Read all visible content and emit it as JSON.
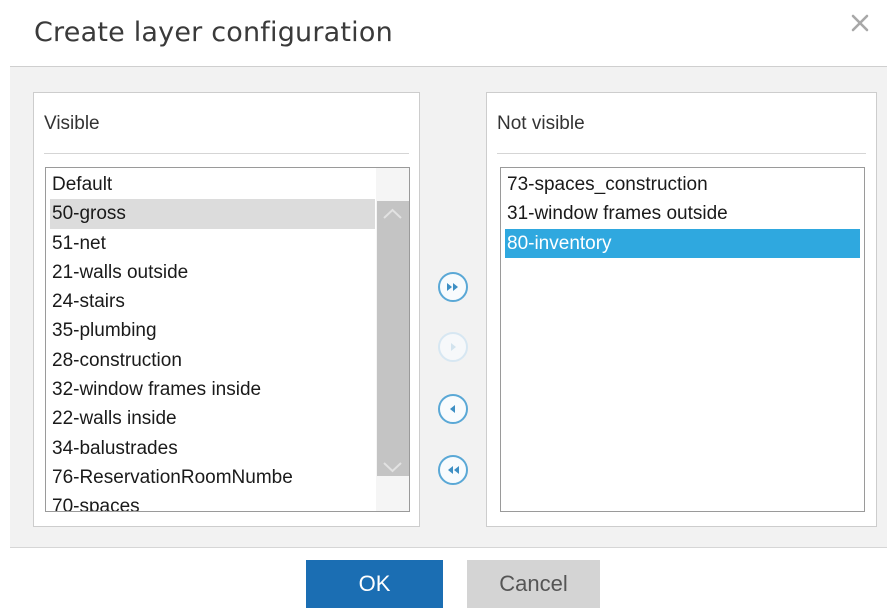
{
  "dialog": {
    "title": "Create layer configuration",
    "close_icon": "close-icon"
  },
  "visible_panel": {
    "header": "Visible",
    "items": [
      {
        "label": "Default",
        "highlighted": false
      },
      {
        "label": "50-gross",
        "highlighted": true
      },
      {
        "label": "51-net",
        "highlighted": false
      },
      {
        "label": "21-walls outside",
        "highlighted": false
      },
      {
        "label": "24-stairs",
        "highlighted": false
      },
      {
        "label": "35-plumbing",
        "highlighted": false
      },
      {
        "label": "28-construction",
        "highlighted": false
      },
      {
        "label": "32-window frames inside",
        "highlighted": false
      },
      {
        "label": "22-walls inside",
        "highlighted": false
      },
      {
        "label": "34-balustrades",
        "highlighted": false
      },
      {
        "label": "76-ReservationRoomNumbe",
        "highlighted": false
      },
      {
        "label": "70-spaces",
        "highlighted": false
      }
    ]
  },
  "not_visible_panel": {
    "header": "Not visible",
    "items": [
      {
        "label": "73-spaces_construction",
        "selected": false
      },
      {
        "label": "31-window frames outside",
        "selected": false
      },
      {
        "label": "80-inventory",
        "selected": true
      }
    ]
  },
  "transfer_buttons": [
    {
      "icon": "double-chevron-right-icon",
      "enabled": true
    },
    {
      "icon": "chevron-right-icon",
      "enabled": false
    },
    {
      "icon": "chevron-left-icon",
      "enabled": true
    },
    {
      "icon": "double-chevron-left-icon",
      "enabled": true
    }
  ],
  "footer": {
    "ok_label": "OK",
    "cancel_label": "Cancel"
  },
  "colors": {
    "primary_button": "#1b6eb3",
    "selection": "#2fa8df",
    "highlight": "#dcdcdc",
    "secondary_button": "#d4d4d4"
  }
}
